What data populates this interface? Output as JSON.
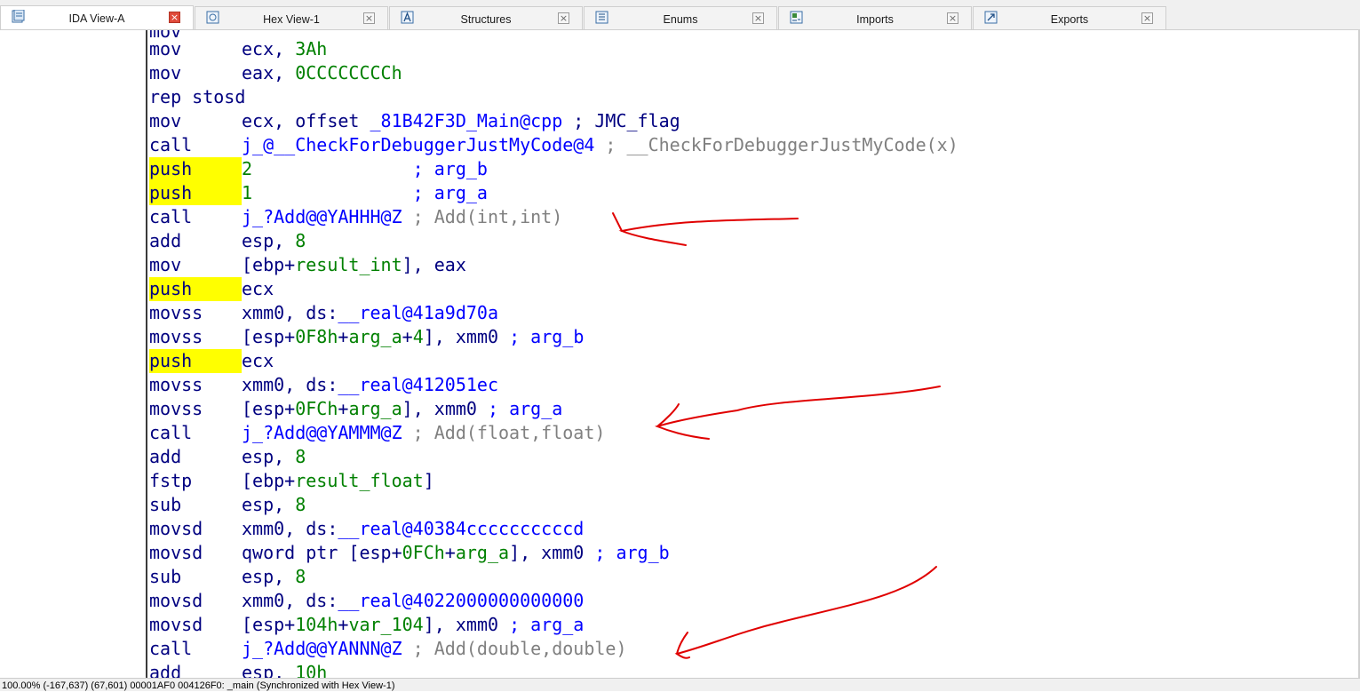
{
  "tabs": [
    {
      "label": "IDA View-A",
      "active": true,
      "icon": "ida-view-icon"
    },
    {
      "label": "Hex View-1",
      "active": false,
      "icon": "hex-view-icon"
    },
    {
      "label": "Structures",
      "active": false,
      "icon": "structures-icon"
    },
    {
      "label": "Enums",
      "active": false,
      "icon": "enums-icon"
    },
    {
      "label": "Imports",
      "active": false,
      "icon": "imports-icon"
    },
    {
      "label": "Exports",
      "active": false,
      "icon": "exports-icon"
    }
  ],
  "close_glyph": "×",
  "code_lines": [
    {
      "mn": "mov",
      "parts": [
        [
          "op",
          "ecx, "
        ],
        [
          "num",
          "3Ah"
        ]
      ]
    },
    {
      "mn": "mov",
      "parts": [
        [
          "op",
          "eax, "
        ],
        [
          "num",
          "0CCCCCCCCh"
        ]
      ]
    },
    {
      "mn": "rep stosd",
      "parts": []
    },
    {
      "mn": "mov",
      "parts": [
        [
          "op",
          "ecx, offset "
        ],
        [
          "sym",
          "_81B42F3D_Main@cpp"
        ],
        [
          "op",
          " ; JMC_flag"
        ]
      ]
    },
    {
      "mn": "call",
      "parts": [
        [
          "sym",
          "j_@__CheckForDebuggerJustMyCode@4"
        ],
        [
          "cmt",
          " ; __CheckForDebuggerJustMyCode(x)"
        ]
      ]
    },
    {
      "mn": "push",
      "hl": true,
      "parts": [
        [
          "num",
          "2"
        ],
        [
          "op",
          "               "
        ],
        [
          "cmtb",
          "; arg_b"
        ]
      ]
    },
    {
      "mn": "push",
      "hl": true,
      "parts": [
        [
          "num",
          "1"
        ],
        [
          "op",
          "               "
        ],
        [
          "cmtb",
          "; arg_a"
        ]
      ]
    },
    {
      "mn": "call",
      "parts": [
        [
          "sym",
          "j_?Add@@YAHHH@Z"
        ],
        [
          "cmt",
          " ; Add(int,int)"
        ]
      ]
    },
    {
      "mn": "add",
      "parts": [
        [
          "op",
          "esp, "
        ],
        [
          "num",
          "8"
        ]
      ]
    },
    {
      "mn": "mov",
      "parts": [
        [
          "op",
          "[ebp+"
        ],
        [
          "stk",
          "result_int"
        ],
        [
          "op",
          "], eax"
        ]
      ]
    },
    {
      "mn": "push",
      "hl": true,
      "parts": [
        [
          "op",
          "ecx"
        ]
      ]
    },
    {
      "mn": "movss",
      "parts": [
        [
          "op",
          "xmm0, ds:"
        ],
        [
          "sym",
          "__real@41a9d70a"
        ]
      ]
    },
    {
      "mn": "movss",
      "parts": [
        [
          "op",
          "[esp+"
        ],
        [
          "num",
          "0F8h"
        ],
        [
          "op",
          "+"
        ],
        [
          "stk",
          "arg_a"
        ],
        [
          "op",
          "+"
        ],
        [
          "num",
          "4"
        ],
        [
          "op",
          "], xmm0 "
        ],
        [
          "cmtb",
          "; arg_b"
        ]
      ]
    },
    {
      "mn": "push",
      "hl": true,
      "parts": [
        [
          "op",
          "ecx"
        ]
      ]
    },
    {
      "mn": "movss",
      "parts": [
        [
          "op",
          "xmm0, ds:"
        ],
        [
          "sym",
          "__real@412051ec"
        ]
      ]
    },
    {
      "mn": "movss",
      "parts": [
        [
          "op",
          "[esp+"
        ],
        [
          "num",
          "0FCh"
        ],
        [
          "op",
          "+"
        ],
        [
          "stk",
          "arg_a"
        ],
        [
          "op",
          "], xmm0 "
        ],
        [
          "cmtb",
          "; arg_a"
        ]
      ]
    },
    {
      "mn": "call",
      "parts": [
        [
          "sym",
          "j_?Add@@YAMMM@Z"
        ],
        [
          "cmt",
          " ; Add(float,float)"
        ]
      ]
    },
    {
      "mn": "add",
      "parts": [
        [
          "op",
          "esp, "
        ],
        [
          "num",
          "8"
        ]
      ]
    },
    {
      "mn": "fstp",
      "parts": [
        [
          "op",
          "[ebp+"
        ],
        [
          "stk",
          "result_float"
        ],
        [
          "op",
          "]"
        ]
      ]
    },
    {
      "mn": "sub",
      "parts": [
        [
          "op",
          "esp, "
        ],
        [
          "num",
          "8"
        ]
      ]
    },
    {
      "mn": "movsd",
      "parts": [
        [
          "op",
          "xmm0, ds:"
        ],
        [
          "sym",
          "__real@40384ccccccccccd"
        ]
      ]
    },
    {
      "mn": "movsd",
      "parts": [
        [
          "op",
          "qword ptr [esp+"
        ],
        [
          "num",
          "0FCh"
        ],
        [
          "op",
          "+"
        ],
        [
          "stk",
          "arg_a"
        ],
        [
          "op",
          "], xmm0 "
        ],
        [
          "cmtb",
          "; arg_b"
        ]
      ]
    },
    {
      "mn": "sub",
      "parts": [
        [
          "op",
          "esp, "
        ],
        [
          "num",
          "8"
        ]
      ]
    },
    {
      "mn": "movsd",
      "parts": [
        [
          "op",
          "xmm0, ds:"
        ],
        [
          "sym",
          "__real@4022000000000000"
        ]
      ]
    },
    {
      "mn": "movsd",
      "parts": [
        [
          "op",
          "[esp+"
        ],
        [
          "num",
          "104h"
        ],
        [
          "op",
          "+"
        ],
        [
          "stk",
          "var_104"
        ],
        [
          "op",
          "], xmm0 "
        ],
        [
          "cmtb",
          "; arg_a"
        ]
      ]
    },
    {
      "mn": "call",
      "parts": [
        [
          "sym",
          "j_?Add@@YANNN@Z"
        ],
        [
          "cmt",
          " ; Add(double,double)"
        ]
      ]
    },
    {
      "mn": "add",
      "parts": [
        [
          "op",
          "esp, "
        ],
        [
          "num",
          "10h"
        ]
      ]
    }
  ],
  "status": "100.00% (-167,637) (67,601) 00001AF0 004126F0: _main (Synchronized with Hex View-1)",
  "colors": {
    "highlight": "#ffff00",
    "annotation": "#e00000",
    "symbol": "#0000ff",
    "number": "#008000",
    "comment": "#808080"
  }
}
